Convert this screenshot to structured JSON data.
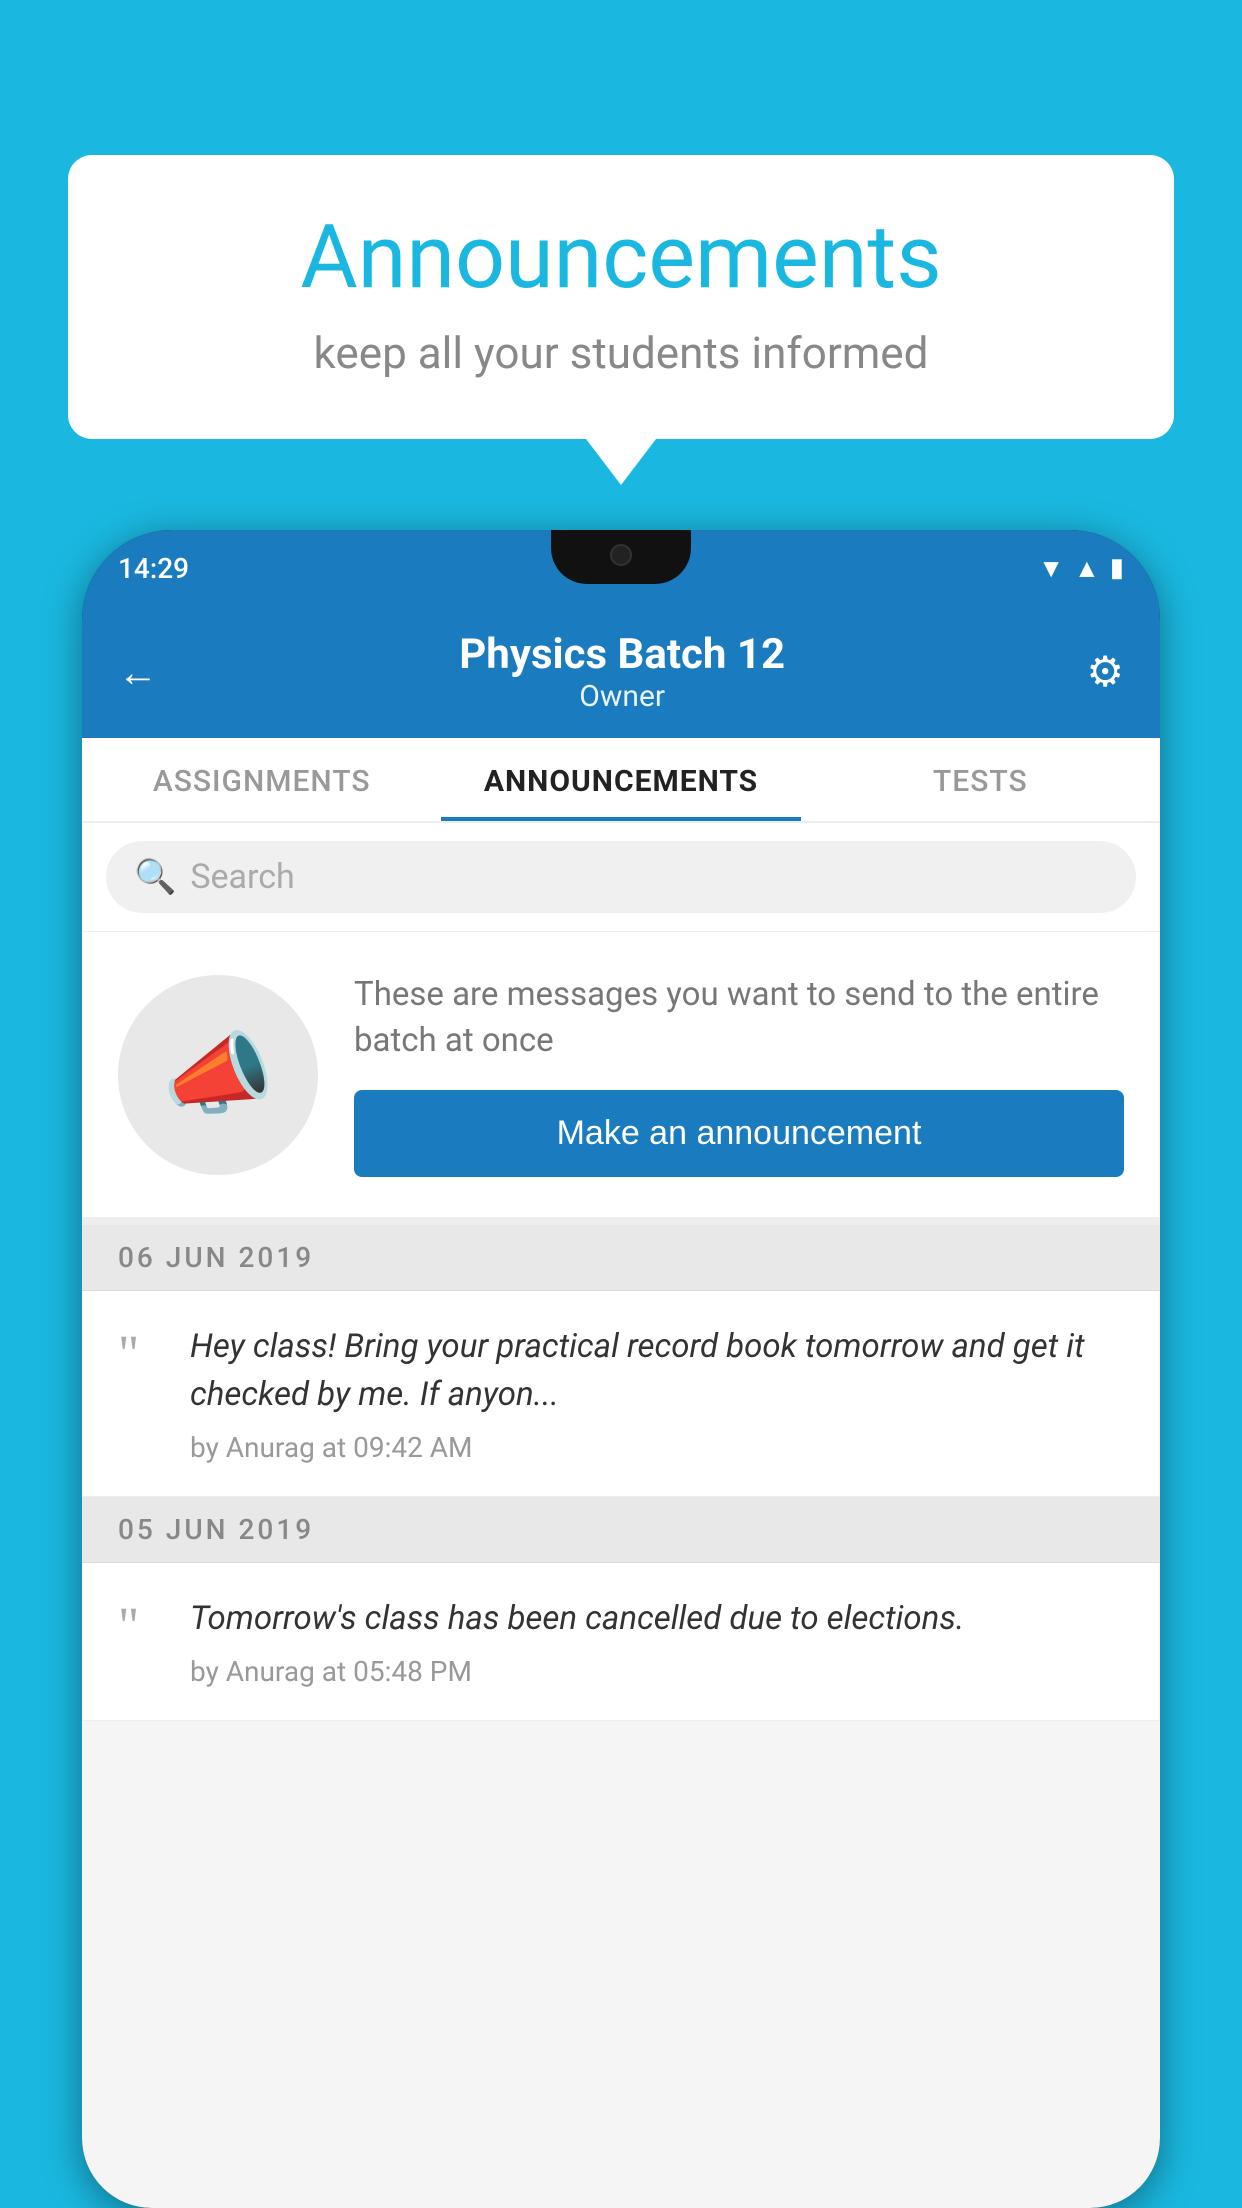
{
  "background_color": "#1ab8e0",
  "speech_bubble": {
    "title": "Announcements",
    "subtitle": "keep all your students informed"
  },
  "phone": {
    "status_bar": {
      "time": "14:29"
    },
    "header": {
      "title": "Physics Batch 12",
      "subtitle": "Owner",
      "back_label": "←",
      "settings_label": "⚙"
    },
    "tabs": [
      {
        "label": "ASSIGNMENTS",
        "active": false
      },
      {
        "label": "ANNOUNCEMENTS",
        "active": true
      },
      {
        "label": "TESTS",
        "active": false
      }
    ],
    "search": {
      "placeholder": "Search"
    },
    "announcement_prompt": {
      "description": "These are messages you want to send to the entire batch at once",
      "button_label": "Make an announcement"
    },
    "announcements": [
      {
        "date": "06  JUN  2019",
        "text": "Hey class! Bring your practical record book tomorrow and get it checked by me. If anyon...",
        "meta": "by Anurag at 09:42 AM"
      },
      {
        "date": "05  JUN  2019",
        "text": "Tomorrow's class has been cancelled due to elections.",
        "meta": "by Anurag at 05:48 PM"
      }
    ]
  }
}
